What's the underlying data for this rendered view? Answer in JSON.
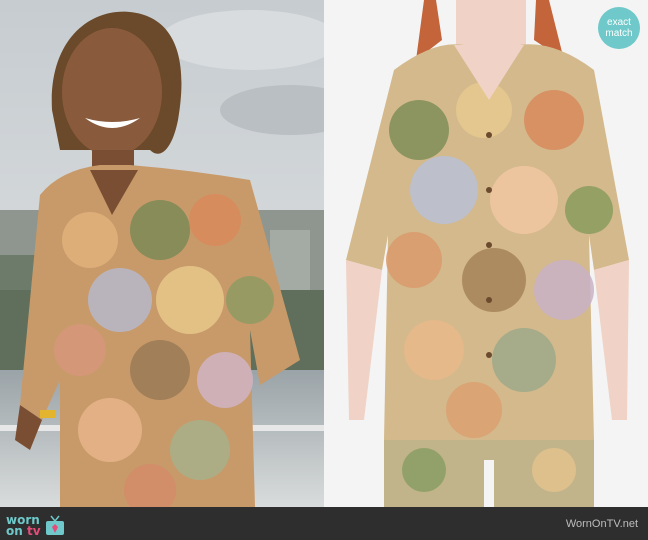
{
  "badge": {
    "line1": "exact",
    "line2": "match"
  },
  "footer": {
    "logo_worn": "worn",
    "logo_on": "on",
    "logo_tv": "tv",
    "credit": "WornOnTV.net"
  },
  "colors": {
    "footer_bg": "#2e2e2e",
    "brand_teal": "#6fc8c9",
    "brand_pink": "#e64b7a"
  },
  "icons": [
    "tv-icon"
  ]
}
